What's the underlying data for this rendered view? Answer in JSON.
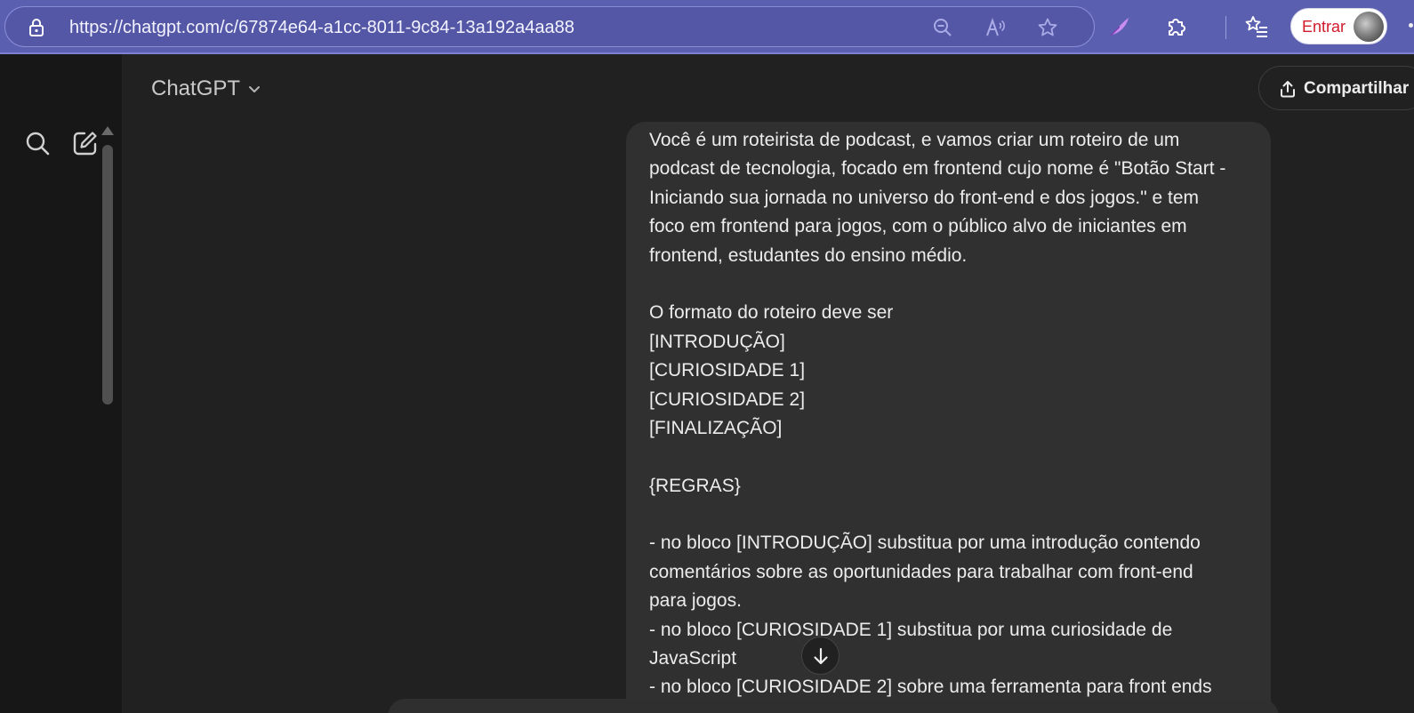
{
  "browser": {
    "url": "https://chatgpt.com/c/67874e64-a1cc-8011-9c84-13a192a4aa88",
    "signin_label": "Entrar",
    "icons": [
      "lock-icon",
      "zoom-out-icon",
      "read-aloud-icon",
      "favorite-star-icon",
      "copilot-feather-icon",
      "extensions-icon",
      "favorites-list-icon",
      "profile-avatar",
      "more-icon"
    ]
  },
  "header": {
    "model_label": "ChatGPT",
    "share_label": "Compartilhar"
  },
  "message": {
    "lines": [
      "Você é um roteirista de podcast, e vamos criar um roteiro de um",
      "podcast de tecnologia, focado em frontend cujo nome é \"Botão Start -",
      "Iniciando sua jornada no universo do front-end e dos jogos.\" e tem",
      "foco em frontend para jogos, com o público alvo de iniciantes em",
      "frontend, estudantes do ensino médio.",
      "",
      "O formato do roteiro deve ser",
      "[INTRODUÇÃO]",
      "[CURIOSIDADE 1]",
      "[CURIOSIDADE 2]",
      "[FINALIZAÇÃO]",
      "",
      "{REGRAS}",
      "",
      "- no bloco [INTRODUÇÃO] substitua por uma introdução contendo",
      "comentários sobre as oportunidades para trabalhar com front-end",
      "para jogos.",
      "- no bloco [CURIOSIDADE 1] substitua por uma curiosidade de",
      "JavaScript",
      "- no bloco [CURIOSIDADE 2] sobre uma ferramenta para front ends"
    ]
  },
  "colors": {
    "browser_bar": "#5b5fb0",
    "background": "#212121",
    "sidebar": "#171717",
    "bubble": "#303030",
    "signin_text": "#d11b2c"
  }
}
